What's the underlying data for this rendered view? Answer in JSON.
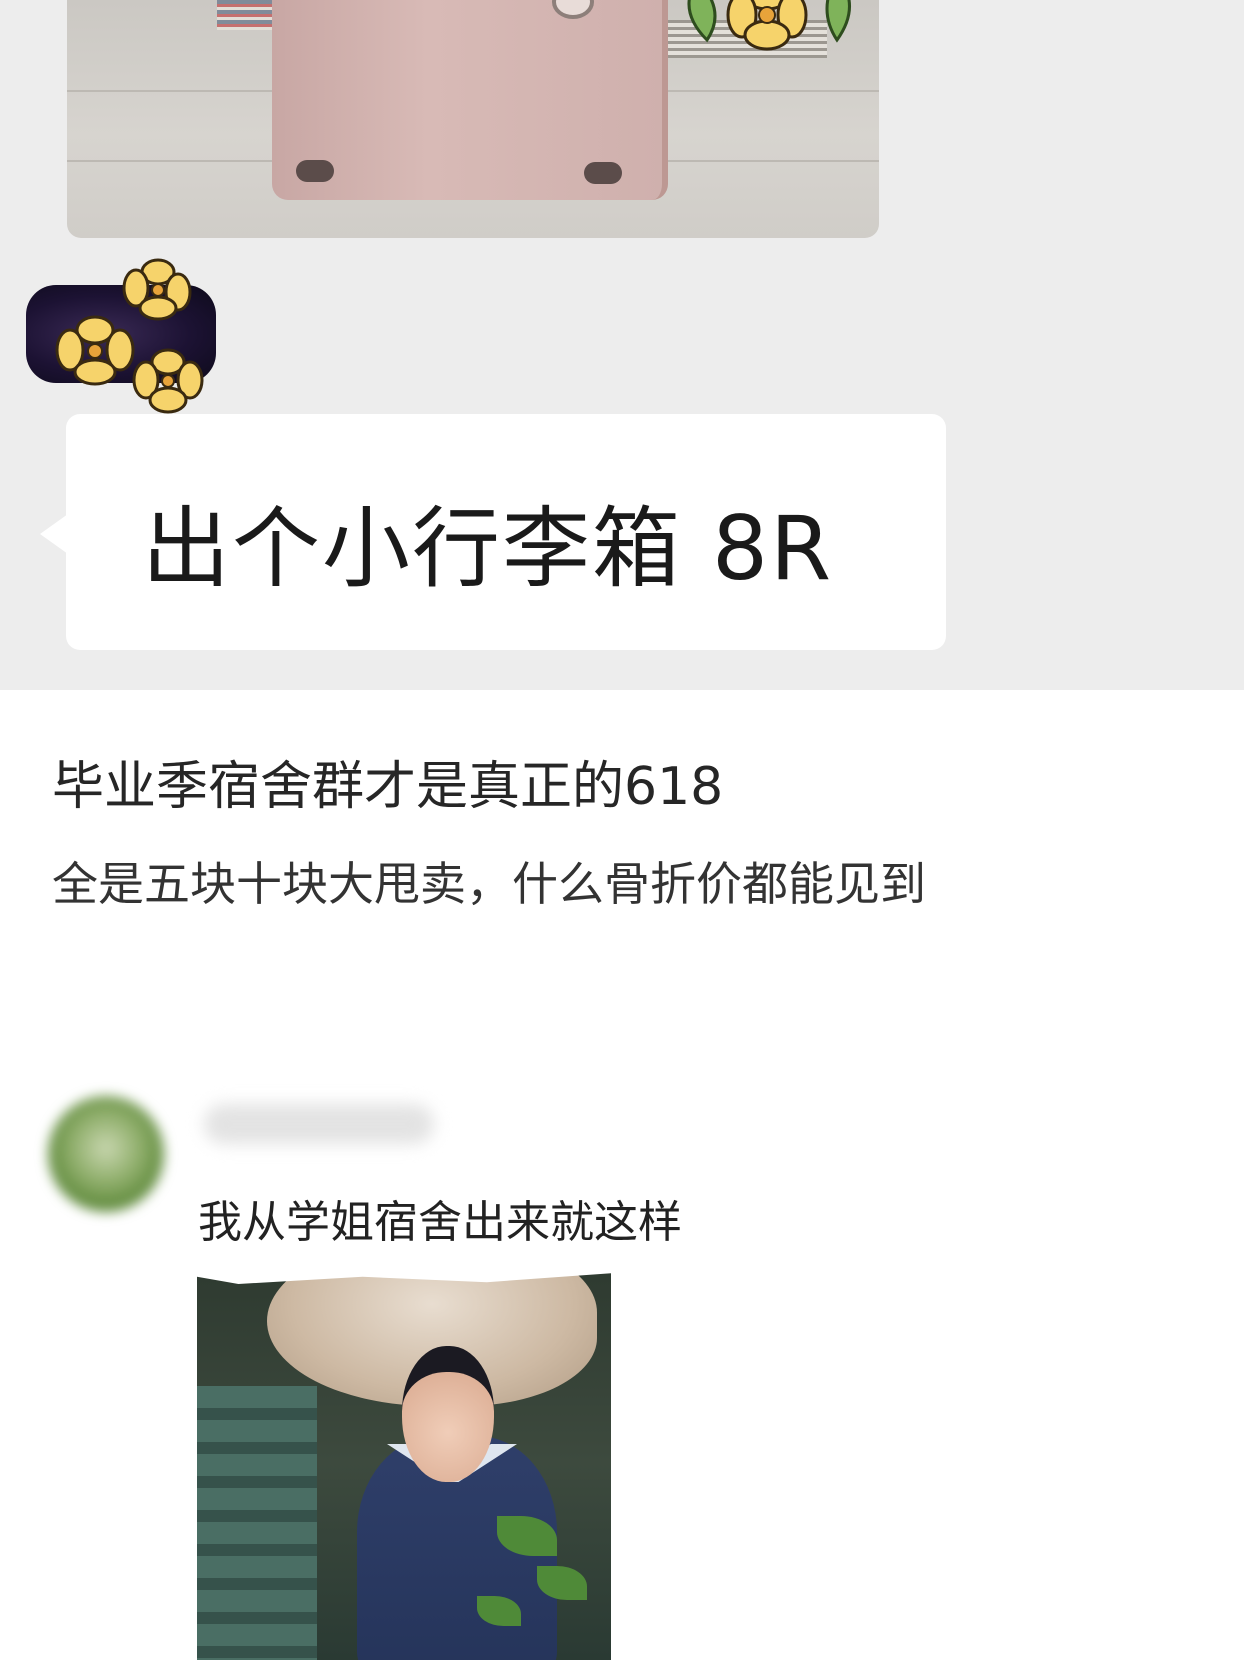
{
  "chat": {
    "bubble_message": "出个小行李箱 8R",
    "sticker_name": "flower-sticker",
    "photo_subject": "suitcase-photo"
  },
  "post": {
    "title": "毕业季宿舍群才是真正的618",
    "subtitle": "全是五块十块大甩卖，什么骨折价都能见到"
  },
  "comment": {
    "username": "",
    "text": "我从学姐宿舍出来就这样",
    "photo_subject": "comment-photo"
  },
  "colors": {
    "chat_background": "#ededed",
    "bubble_background": "#ffffff",
    "page_background": "#ffffff",
    "text_primary": "#1a1a1a"
  }
}
